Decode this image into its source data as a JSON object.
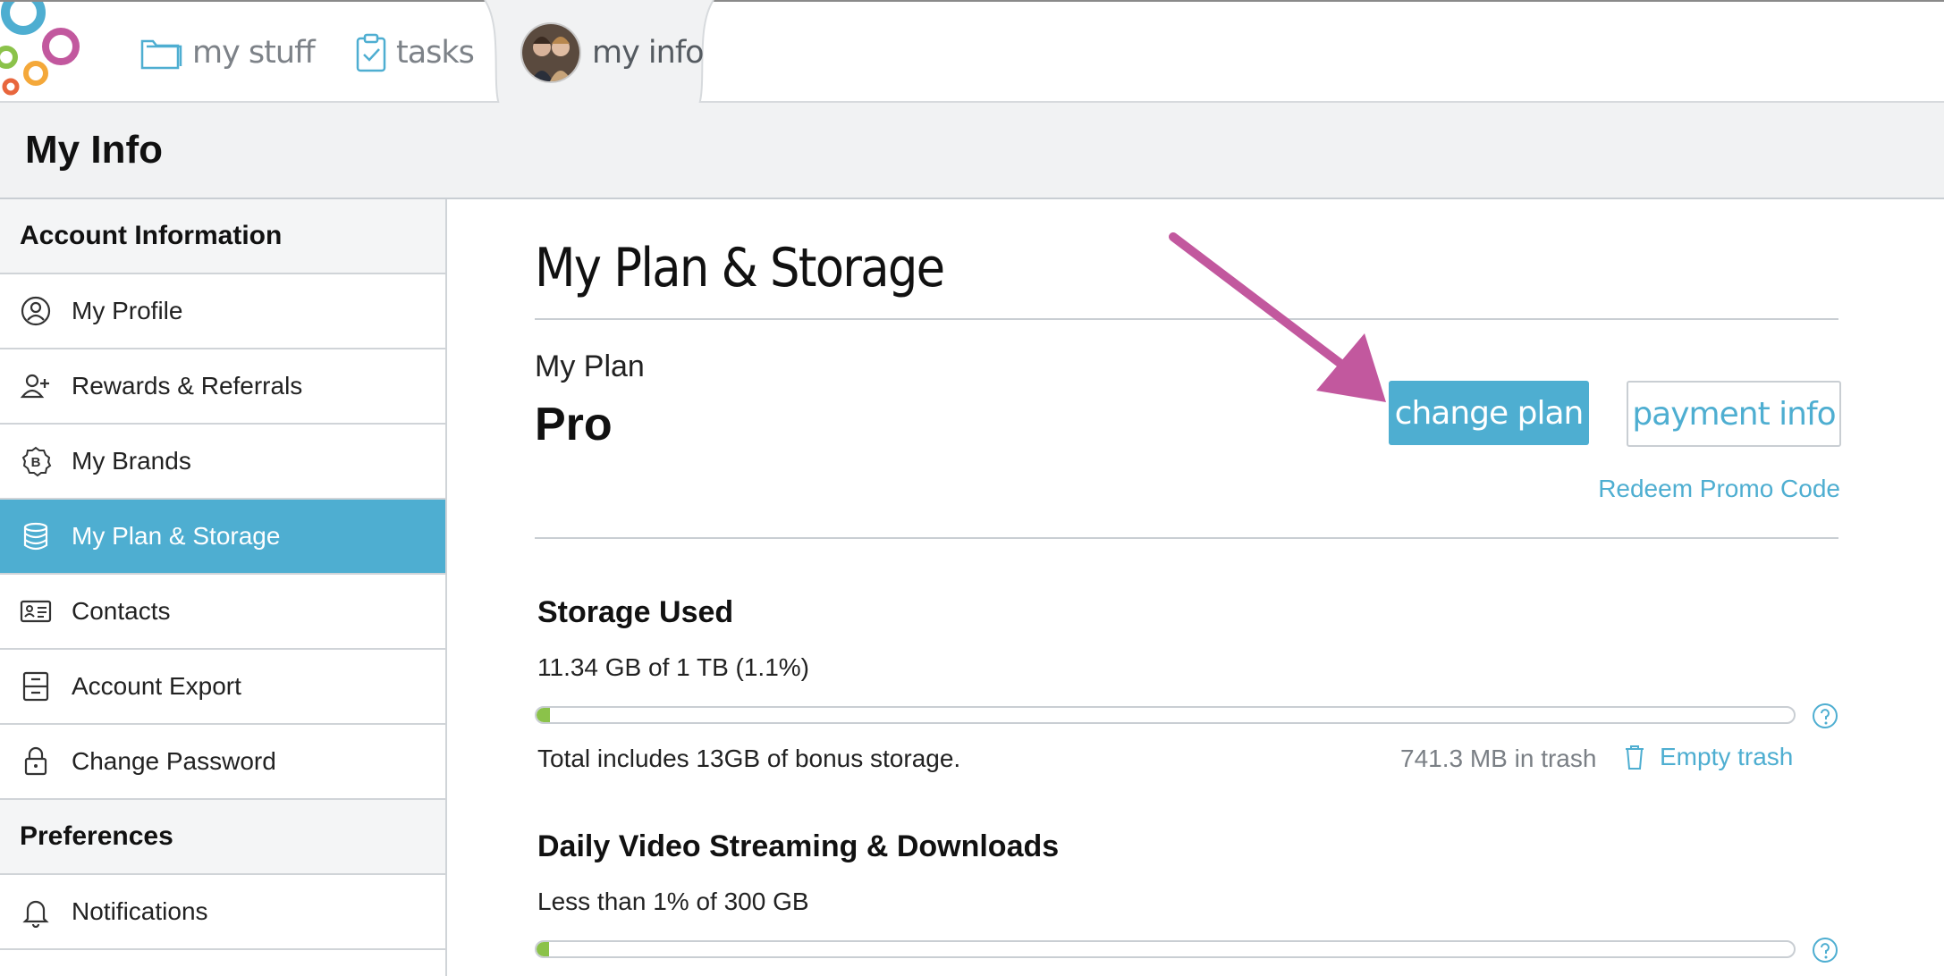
{
  "nav": {
    "tabs": [
      {
        "label": "my stuff",
        "icon": "folder-icon"
      },
      {
        "label": "tasks",
        "icon": "clipboard-check-icon"
      },
      {
        "label": "my info",
        "icon": "avatar",
        "active": true
      }
    ]
  },
  "page": {
    "title": "My Info"
  },
  "sidebar": {
    "sections": [
      {
        "title": "Account Information"
      },
      {
        "title": "Preferences"
      }
    ],
    "items": [
      {
        "label": "My Profile",
        "icon": "user-circle-icon"
      },
      {
        "label": "Rewards & Referrals",
        "icon": "user-plus-icon"
      },
      {
        "label": "My Brands",
        "icon": "brand-badge-icon"
      },
      {
        "label": "My Plan & Storage",
        "icon": "database-icon",
        "active": true
      },
      {
        "label": "Contacts",
        "icon": "contact-card-icon"
      },
      {
        "label": "Account Export",
        "icon": "archive-icon"
      },
      {
        "label": "Change Password",
        "icon": "lock-icon"
      },
      {
        "label": "Notifications",
        "icon": "bell-icon"
      }
    ]
  },
  "main": {
    "heading": "My Plan & Storage",
    "plan_label": "My Plan",
    "plan_name": "Pro",
    "change_plan_label": "change plan",
    "payment_info_label": "payment info",
    "promo_label": "Redeem Promo Code",
    "storage": {
      "title": "Storage Used",
      "summary": "11.34 GB of 1 TB (1.1%)",
      "percent": 1.1,
      "note": "Total includes 13GB of bonus storage.",
      "trash": "741.3 MB in trash",
      "empty_trash_label": "Empty trash"
    },
    "streaming": {
      "title": "Daily Video Streaming & Downloads",
      "summary": "Less than 1% of 300 GB",
      "percent": 1
    }
  },
  "colors": {
    "accent": "#4eaed1",
    "progress": "#8bc24a",
    "arrow": "#c2589e"
  }
}
